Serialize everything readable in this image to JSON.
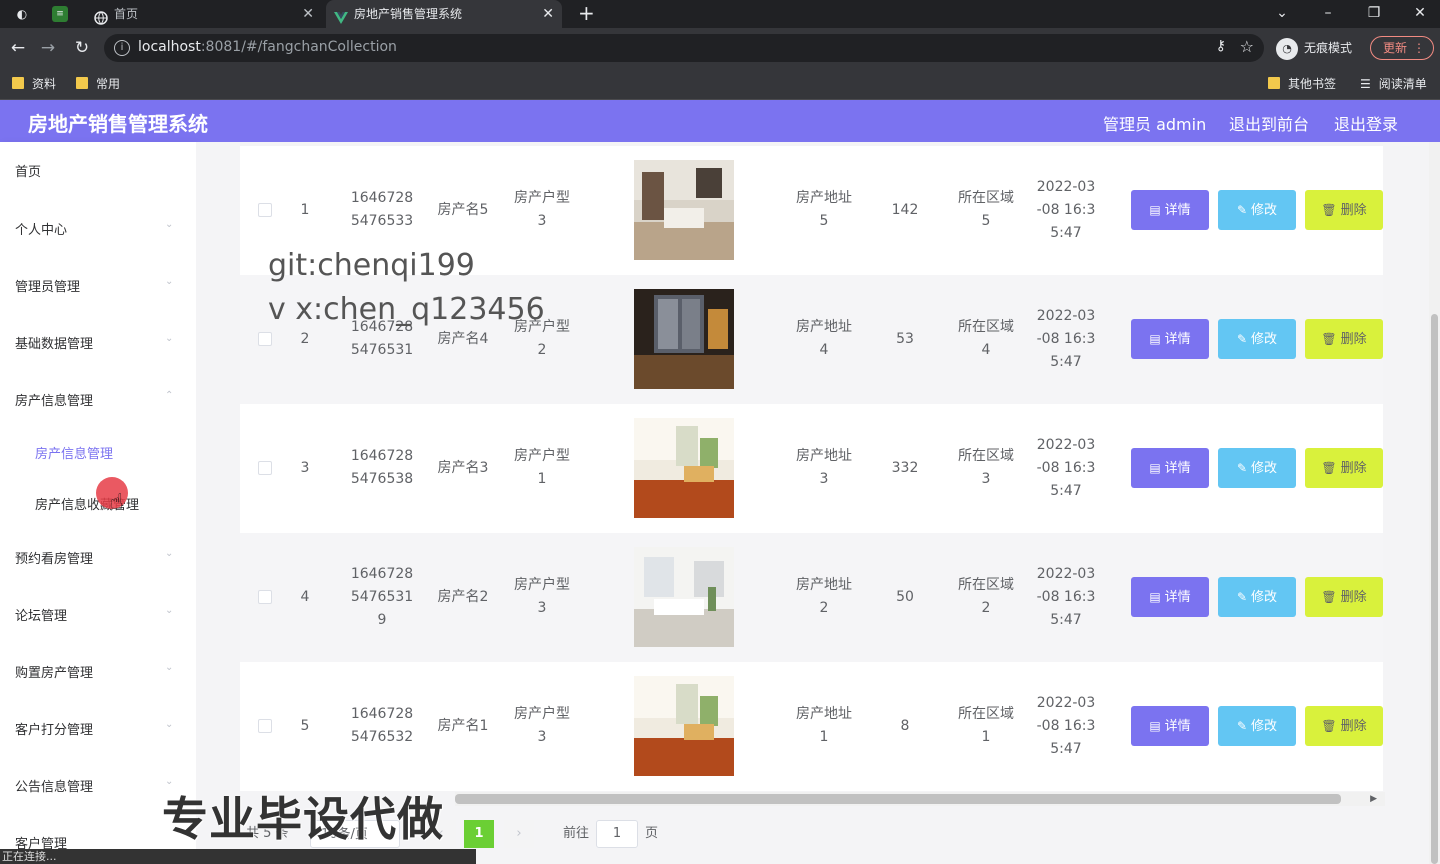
{
  "browser": {
    "tabs": [
      {
        "title": "首页",
        "active": false
      },
      {
        "title": "房地产销售管理系统",
        "active": true
      }
    ],
    "url_host": "localhost",
    "url_rest": ":8081/#/fangchanCollection",
    "incognito_label": "无痕模式",
    "update_label": "更新",
    "bookmarks": {
      "left": [
        "资料",
        "常用"
      ],
      "right": [
        "其他书签",
        "阅读清单"
      ]
    },
    "status_text": "正在连接..."
  },
  "header": {
    "title": "房地产销售管理系统",
    "user": "管理员 admin",
    "to_front": "退出到前台",
    "logout": "退出登录"
  },
  "sidebar": {
    "items": [
      {
        "label": "首页"
      },
      {
        "label": "个人中心"
      },
      {
        "label": "管理员管理"
      },
      {
        "label": "基础数据管理"
      },
      {
        "label": "房产信息管理"
      },
      {
        "label": "预约看房管理"
      },
      {
        "label": "论坛管理"
      },
      {
        "label": "购置房产管理"
      },
      {
        "label": "客户打分管理"
      },
      {
        "label": "公告信息管理"
      },
      {
        "label": "客户管理"
      }
    ],
    "sub_items": [
      {
        "label": "房产信息管理",
        "active": true
      },
      {
        "label": "房产信息收藏管理",
        "active": false
      }
    ]
  },
  "table": {
    "rows": [
      {
        "index": "1",
        "id": [
          "1646728",
          "5476533"
        ],
        "name": "房产名5",
        "type": [
          "房产户型",
          "3"
        ],
        "address": [
          "房产地址",
          "5"
        ],
        "area": "142",
        "region": [
          "所在区域",
          "5"
        ],
        "time": [
          "2022-03",
          "-08 16:3",
          "5:47"
        ],
        "photo": "photo-living-room-dark"
      },
      {
        "index": "2",
        "id": [
          "1646728",
          "5476531"
        ],
        "name": "房产名4",
        "type": [
          "房产户型",
          "2"
        ],
        "address": [
          "房产地址",
          "4"
        ],
        "area": "53",
        "region": [
          "所在区域",
          "4"
        ],
        "time": [
          "2022-03",
          "-08 16:3",
          "5:47"
        ],
        "photo": "photo-living-room-night"
      },
      {
        "index": "3",
        "id": [
          "1646728",
          "5476538"
        ],
        "name": "房产名3",
        "type": [
          "房产户型",
          "1"
        ],
        "address": [
          "房产地址",
          "3"
        ],
        "area": "332",
        "region": [
          "所在区域",
          "3"
        ],
        "time": [
          "2022-03",
          "-08 16:3",
          "5:47"
        ],
        "photo": "photo-wood-floor"
      },
      {
        "index": "4",
        "id": [
          "1646728",
          "5476531",
          "9"
        ],
        "name": "房产名2",
        "type": [
          "房产户型",
          "3"
        ],
        "address": [
          "房产地址",
          "2"
        ],
        "area": "50",
        "region": [
          "所在区域",
          "2"
        ],
        "time": [
          "2022-03",
          "-08 16:3",
          "5:47"
        ],
        "photo": "photo-bright-room"
      },
      {
        "index": "5",
        "id": [
          "1646728",
          "5476532"
        ],
        "name": "房产名1",
        "type": [
          "房产户型",
          "3"
        ],
        "address": [
          "房产地址",
          "1"
        ],
        "area": "8",
        "region": [
          "所在区域",
          "1"
        ],
        "time": [
          "2022-03",
          "-08 16:3",
          "5:47"
        ],
        "photo": "photo-wood-floor"
      }
    ],
    "actions": {
      "detail": "详情",
      "edit": "修改",
      "delete": "删除"
    }
  },
  "pagination": {
    "total_text": "共 5 条",
    "page_size_text": "10条/页",
    "current": "1",
    "goto_prefix": "前往",
    "goto_value": "1",
    "goto_suffix": "页"
  },
  "overlays": {
    "git": "git:chenqi199",
    "vx": "v x:chen_q123456",
    "ad": "专业毕设代做"
  },
  "colors": {
    "accent": "#7b73f0",
    "edit": "#63c6f3",
    "delete": "#d9f13c",
    "page_active": "#6bcf34"
  }
}
